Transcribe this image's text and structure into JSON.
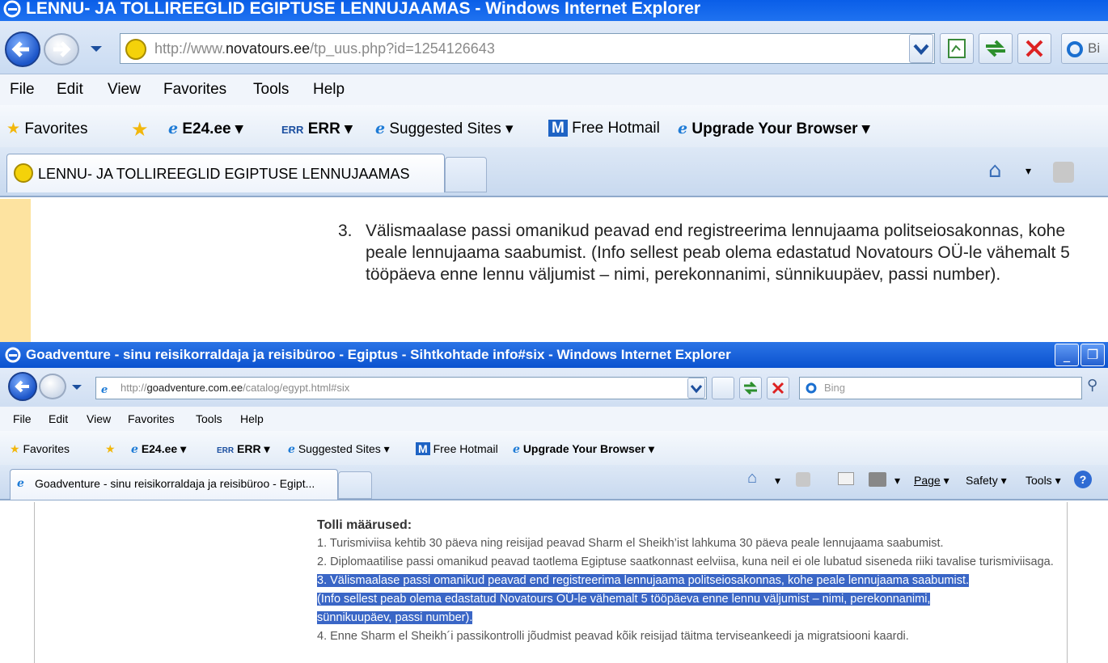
{
  "window1": {
    "title": "LENNU- JA TOLLIREEGLID EGIPTUSE LENNUJAAMAS - Windows Internet Explorer",
    "address": {
      "prefix": "http://www.",
      "domain": "novatours.ee",
      "path": "/tp_uus.php?id=1254126643"
    },
    "search_placeholder": "Bi",
    "menu": [
      "File",
      "Edit",
      "View",
      "Favorites",
      "Tools",
      "Help"
    ],
    "favorites_bar": {
      "favorites": "Favorites",
      "items": [
        "E24.ee",
        "ERR",
        "Suggested Sites",
        "Free Hotmail",
        "Upgrade Your Browser"
      ]
    },
    "tab_title": "LENNU- JA TOLLIREEGLID EGIPTUSE LENNUJAAMAS",
    "content": {
      "number": "3.",
      "text": "Välismaalase passi omanikud peavad end registreerima lennujaama politseiosakonnas, kohe peale lennujaama saabumist. (Info sellest peab olema edastatud Novatours OÜ-le vähemalt 5 tööpäeva enne lennu väljumist – nimi, perekonnanimi, sünnikuupäev, passi number)."
    }
  },
  "window2": {
    "title": "Goadventure - sinu reisikorraldaja ja reisibüroo - Egiptus - Sihtkohtade info#six - Windows Internet Explorer",
    "address": {
      "prefix": "http://",
      "domain": "goadventure.com.ee",
      "path": "/catalog/egypt.html#six"
    },
    "search_placeholder": "Bing",
    "menu": [
      "File",
      "Edit",
      "View",
      "Favorites",
      "Tools",
      "Help"
    ],
    "favorites_bar": {
      "favorites": "Favorites",
      "items": [
        "E24.ee",
        "ERR",
        "Suggested Sites",
        "Free Hotmail",
        "Upgrade Your Browser"
      ]
    },
    "tab_title": "Goadventure - sinu reisikorraldaja ja reisibüroo - Egipt...",
    "command_bar": [
      "Page",
      "Safety",
      "Tools"
    ],
    "content": {
      "heading": "Tolli määrused:",
      "item1": "1. Turismiviisa kehtib 30 päeva ning reisijad peavad Sharm el Sheikh’ist lahkuma 30 päeva peale lennujaama saabumist.",
      "item2": "2. Diplomaatilise passi omanikud peavad taotlema Egiptuse saatkonnast eelviisa, kuna neil ei ole lubatud siseneda riiki tavalise turismiviisaga.",
      "item3_line1": "3. Välismaalase passi omanikud peavad end registreerima lennujaama politseiosakonnas, kohe peale lennujaama saabumist.",
      "item3_line2": "(Info sellest peab olema edastatud Novatours OÜ-le vähemalt 5 tööpäeva enne lennu väljumist – nimi, perekonnanimi,",
      "item3_line3": "sünnikuupäev, passi number).",
      "item4": "4. Enne Sharm el Sheikh´i passikontrolli jõudmist peavad kõik reisijad täitma terviseankeedi ja migratsiooni kaardi."
    }
  }
}
